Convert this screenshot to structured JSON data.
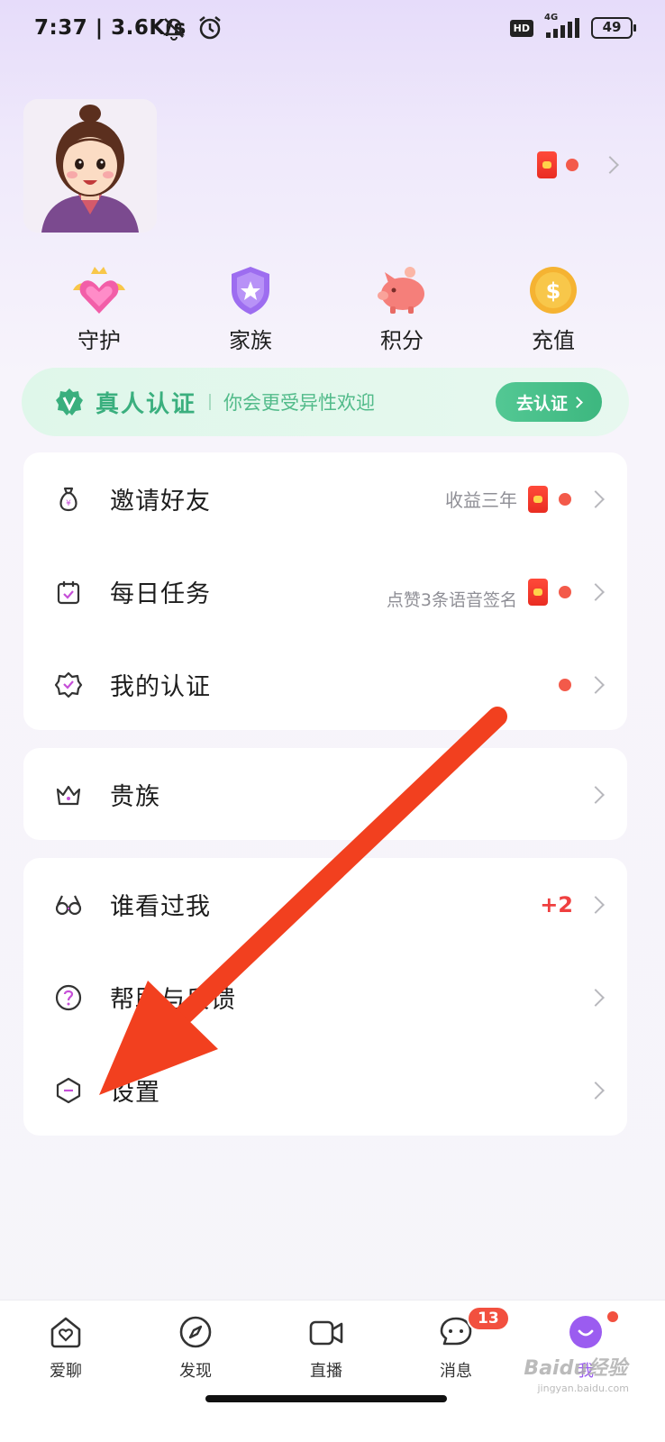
{
  "status_bar": {
    "time": "7:37",
    "speed": "| 3.6K/s",
    "hd": "HD",
    "network": "4G",
    "battery": "49"
  },
  "profile": {
    "avatar_icon": "cartoon-woman-avatar",
    "has_redpacket": true
  },
  "quick_actions": [
    {
      "label": "守护",
      "icon": "guard-heart-crown-icon"
    },
    {
      "label": "家族",
      "icon": "family-shield-icon"
    },
    {
      "label": "积分",
      "icon": "piggy-bank-icon"
    },
    {
      "label": "充值",
      "icon": "coin-dollar-icon"
    }
  ],
  "verify_banner": {
    "title": "真人认证",
    "subtitle": "你会更受异性欢迎",
    "button": "去认证"
  },
  "menu_group_1": [
    {
      "label": "邀请好友",
      "sub": "收益三年",
      "icon": "money-bag-icon"
    },
    {
      "label": "每日任务",
      "sub": "点赞3条语音签名",
      "icon": "calendar-check-icon"
    },
    {
      "label": "我的认证",
      "sub": "",
      "icon": "badge-check-icon"
    }
  ],
  "menu_group_2": [
    {
      "label": "贵族",
      "icon": "crown-icon"
    }
  ],
  "menu_group_3": [
    {
      "label": "谁看过我",
      "count": "+2",
      "icon": "glasses-icon"
    },
    {
      "label": "帮助与反馈",
      "icon": "question-circle-icon"
    },
    {
      "label": "设置",
      "icon": "hexagon-settings-icon"
    }
  ],
  "tabbar": {
    "tabs": [
      {
        "label": "爱聊",
        "icon": "home-heart-icon"
      },
      {
        "label": "发现",
        "icon": "compass-icon"
      },
      {
        "label": "直播",
        "icon": "video-camera-icon"
      },
      {
        "label": "消息",
        "icon": "chat-bubble-icon",
        "badge": "13"
      },
      {
        "label": "我",
        "icon": "me-smile-icon"
      }
    ]
  },
  "watermark": {
    "text": "Baidu经验",
    "sub": "jingyan.baidu.com"
  },
  "colors": {
    "accent_green": "#3aaf7e",
    "accent_red": "#f35a4a",
    "accent_purple": "#9b5cf0"
  }
}
